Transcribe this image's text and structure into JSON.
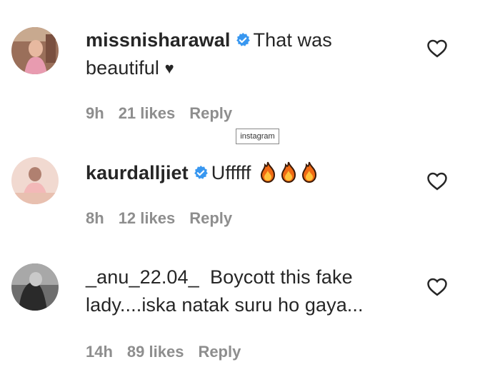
{
  "watermark": "instagram",
  "comments": [
    {
      "username": "missnisharawal",
      "verified": true,
      "text_line1": "That was",
      "text_line2": "beautiful",
      "suffix": "♥",
      "time": "9h",
      "likes": "21 likes",
      "reply": "Reply"
    },
    {
      "username": "kaurdalljiet",
      "verified": true,
      "text_line1": "Ufffff",
      "emoji": "fire-icon x3",
      "time": "8h",
      "likes": "12 likes",
      "reply": "Reply"
    },
    {
      "username": "_anu_22.04_",
      "verified": false,
      "text_line1": "Boycott this fake",
      "text_line2": "lady....iska natak suru ho gaya...",
      "time": "14h",
      "likes": "89 likes",
      "reply": "Reply"
    }
  ],
  "colors": {
    "verified_blue": "#3897f0",
    "meta_gray": "#8e8e8e",
    "text": "#262626"
  }
}
